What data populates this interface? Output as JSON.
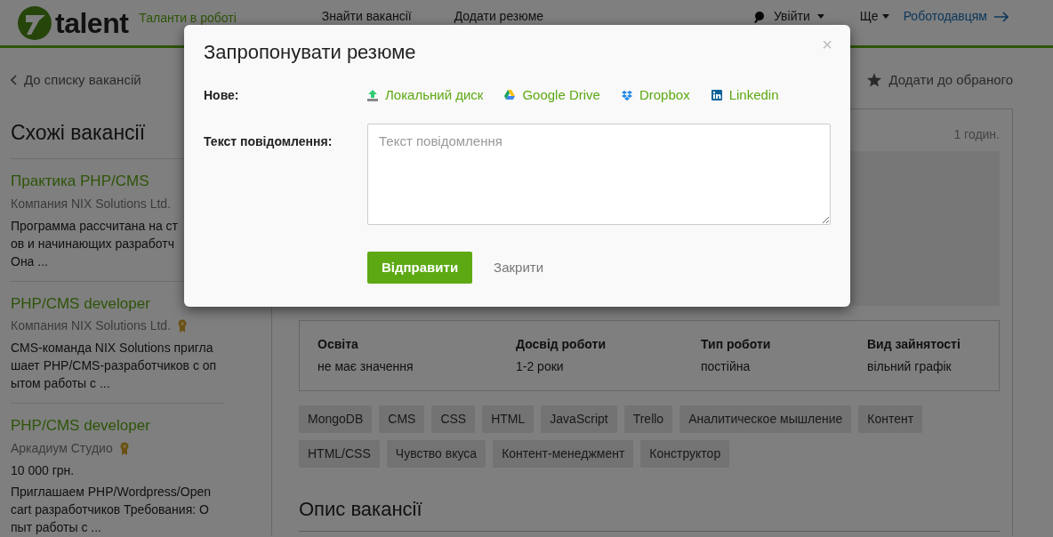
{
  "header": {
    "logo_text": "talent",
    "tagline": "Таланти в роботі",
    "nav": [
      "Знайти вакансії",
      "Додати резюме"
    ],
    "login": "Увійти",
    "more": "Ще",
    "employers": "Роботодавцям"
  },
  "back_link": "До списку вакансій",
  "favorite": "Додати до обраного",
  "sidebar": {
    "title": "Схожі вакансії",
    "jobs": [
      {
        "title": "Практика PHP/CMS",
        "company": "Компания NIX Solutions Ltd.",
        "badge": false,
        "description_lines": [
          "Программа рассчитана на ст",
          "ов и начинающих разработч",
          "Она ..."
        ]
      },
      {
        "title": "PHP/CMS developer",
        "company": "Компания NIX Solutions Ltd.",
        "badge": true,
        "description_lines": [
          "CMS-команда NIX Solutions пригла",
          "шает PHP/CMS-разработчиков с оп",
          "ытом работы с ..."
        ]
      },
      {
        "title": "PHP/CMS developer",
        "company": "Аркадиум Студио",
        "badge": true,
        "salary": "10 000 грн.",
        "description_lines": [
          "Приглашаем PHP/Wordpress/Open",
          "cart разработчиков Требования: О",
          "пыт работы с ..."
        ]
      }
    ]
  },
  "main": {
    "posted": "1 годин.",
    "facts": [
      {
        "label": "Освіта",
        "value": "не має значення"
      },
      {
        "label": "Досвід роботи",
        "value": "1-2 роки"
      },
      {
        "label": "Тип роботи",
        "value": "постійна"
      },
      {
        "label": "Вид зайнятості",
        "value": "вільний графік"
      }
    ],
    "tags": [
      "MongoDB",
      "CMS",
      "CSS",
      "HTML",
      "JavaScript",
      "Trello",
      "Аналитическое мышление",
      "Контент",
      "HTML/CSS",
      "Чувство вкуса",
      "Контент-менеджмент",
      "Конструктор"
    ],
    "section_title": "Опис вакансії"
  },
  "modal": {
    "title": "Запропонувати резюме",
    "close_symbol": "×",
    "new_label": "Нове:",
    "sources": [
      {
        "kind": "upload",
        "label": "Локальний диск"
      },
      {
        "kind": "gdrive",
        "label": "Google Drive"
      },
      {
        "kind": "dropbox",
        "label": "Dropbox"
      },
      {
        "kind": "linkedin",
        "label": "Linkedin"
      }
    ],
    "message_label": "Текст повідомлення:",
    "message_placeholder": "Текст повідомлення",
    "submit": "Відправити",
    "close_link": "Закрити"
  }
}
